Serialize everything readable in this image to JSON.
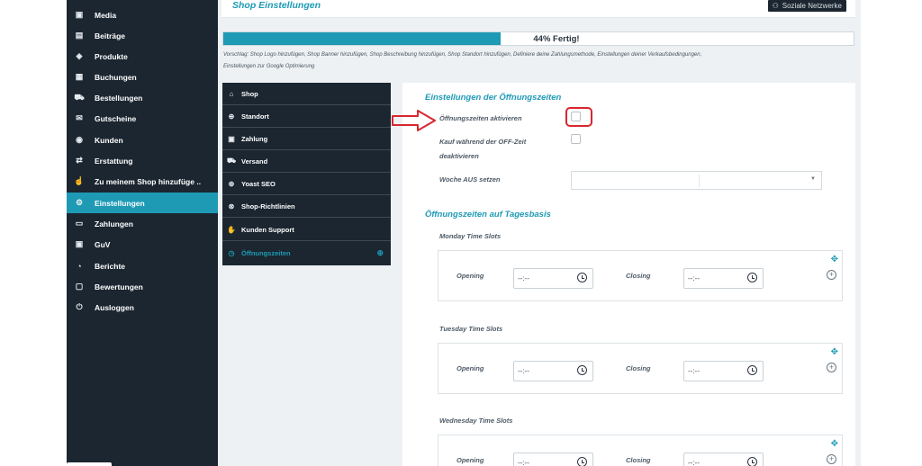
{
  "sidebar": {
    "items": [
      {
        "label": "Media",
        "icon": "image-icon",
        "glyph": "▣"
      },
      {
        "label": "Beiträge",
        "icon": "document-icon",
        "glyph": "▤"
      },
      {
        "label": "Produkte",
        "icon": "box-icon",
        "glyph": "◈"
      },
      {
        "label": "Buchungen",
        "icon": "calendar-icon",
        "glyph": "▦"
      },
      {
        "label": "Bestellungen",
        "icon": "cart-icon",
        "glyph": "⛟"
      },
      {
        "label": "Gutscheine",
        "icon": "gift-icon",
        "glyph": "✉"
      },
      {
        "label": "Kunden",
        "icon": "user-icon",
        "glyph": "◉"
      },
      {
        "label": "Erstattung",
        "icon": "refund-icon",
        "glyph": "⇄"
      },
      {
        "label": "Zu meinem Shop hinzufüge ..",
        "icon": "hand-pointer-icon",
        "glyph": "☝"
      },
      {
        "label": "Einstellungen",
        "icon": "gears-icon",
        "glyph": "⚙"
      },
      {
        "label": "Zahlungen",
        "icon": "credit-card-icon",
        "glyph": "▭"
      },
      {
        "label": "GuV",
        "icon": "money-icon",
        "glyph": "▣"
      },
      {
        "label": "Berichte",
        "icon": "pie-chart-icon",
        "glyph": "◔"
      },
      {
        "label": "Bewertungen",
        "icon": "comment-icon",
        "glyph": "▢"
      },
      {
        "label": "Ausloggen",
        "icon": "power-icon",
        "glyph": "⏻"
      }
    ],
    "active_index": 9
  },
  "header": {
    "title": "Shop Einstellungen",
    "social_label": "Soziale Netzwerke"
  },
  "progress": {
    "percent": 44,
    "label": "44% Fertig!"
  },
  "suggestion": "Vorschlag: Shop Logo hinzufügen, Shop Banner hinzufügen, Shop Beschreibung hinzufügen, Shop Standort hinzufügen, Definiere deine Zahlungsmethode, Einstellungen deiner Verkaufsbedingungen, Einstellungen zur Google Optimierung",
  "tabs": [
    {
      "label": "Shop",
      "icon": "bag-icon",
      "glyph": "⌂"
    },
    {
      "label": "Standort",
      "icon": "globe-icon",
      "glyph": "⊕"
    },
    {
      "label": "Zahlung",
      "icon": "money-icon",
      "glyph": "▣"
    },
    {
      "label": "Versand",
      "icon": "truck-icon",
      "glyph": "⛟"
    },
    {
      "label": "Yoast SEO",
      "icon": "globe-icon",
      "glyph": "⊕"
    },
    {
      "label": "Shop-Richtlinien",
      "icon": "bike-icon",
      "glyph": "⊗"
    },
    {
      "label": "Kunden Support",
      "icon": "thumbs-up-icon",
      "glyph": "✋"
    },
    {
      "label": "Öffnungszeiten",
      "icon": "clock-icon",
      "glyph": "◷"
    }
  ],
  "active_tab": 7,
  "opening": {
    "section_title": "Einstellungen der Öffnungszeiten",
    "enable_label": "Öffnungszeiten aktivieren",
    "offtime_label_1": "Kauf während der OFF-Zeit",
    "offtime_label_2": "deaktivieren",
    "week_off_label": "Woche AUS setzen",
    "daily_title": "Öffnungszeiten auf Tagesbasis",
    "opening_label": "Opening",
    "closing_label": "Closing",
    "time_placeholder": "--:--",
    "slots": [
      {
        "title": "Monday Time Slots"
      },
      {
        "title": "Tuesday Time Slots"
      },
      {
        "title": "Wednesday Time Slots"
      }
    ]
  },
  "colors": {
    "accent": "#1e9ab5",
    "sidebar_bg": "#1b2631",
    "highlight": "#d8262f"
  }
}
